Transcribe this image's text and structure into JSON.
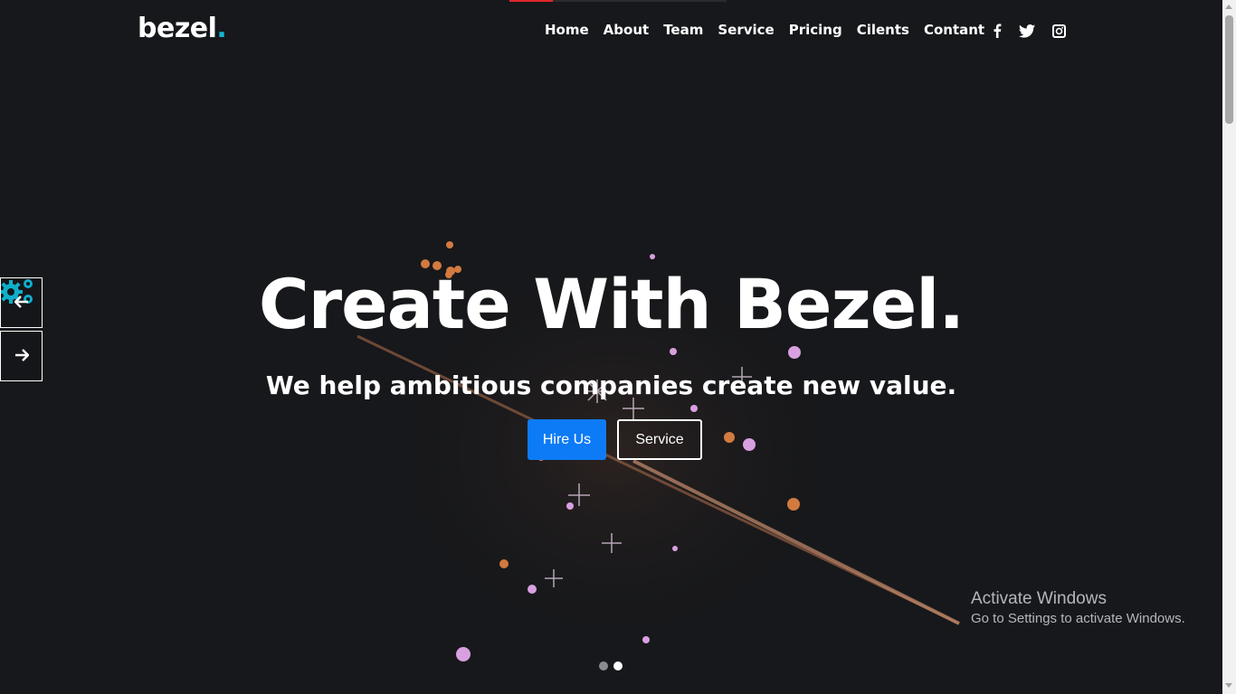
{
  "brand": {
    "name": "bezel",
    "dot": "."
  },
  "nav": {
    "items": [
      {
        "label": "Home"
      },
      {
        "label": "About"
      },
      {
        "label": "Team"
      },
      {
        "label": "Service"
      },
      {
        "label": "Pricing"
      },
      {
        "label": "Cilents"
      },
      {
        "label": "Contant"
      }
    ]
  },
  "social": {
    "icons": [
      "facebook-icon",
      "twitter-icon",
      "instagram-icon"
    ]
  },
  "hero": {
    "title": "Create With Bezel.",
    "subtitle": "We help ambitious companies create new value.",
    "primary_button": "Hire Us",
    "secondary_button": "Service"
  },
  "slider": {
    "slide_count": 2,
    "active_index": 1
  },
  "colors": {
    "accent": "#10b8d6",
    "primary_button": "#0d7bf5",
    "background": "#17181b"
  },
  "overlay": {
    "activate_title": "Activate Windows",
    "activate_subtitle": "Go to Settings to activate Windows."
  }
}
